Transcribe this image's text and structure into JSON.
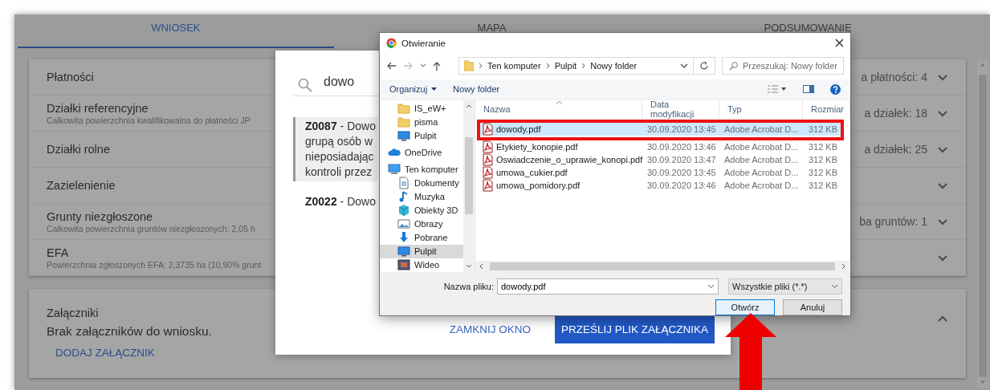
{
  "tabs": [
    {
      "label": "WNIOSEK",
      "selected": true
    },
    {
      "label": "MAPA",
      "selected": false
    },
    {
      "label": "PODSUMOWANIE",
      "selected": false
    }
  ],
  "sections": [
    {
      "title": "Płatności",
      "summary": "a płatności: 4",
      "expanded": false
    },
    {
      "title": "Działki referencyjne",
      "subtitle": "Całkowita powierzchnia kwalifikowalna do płatności JP",
      "summary": "a działek: 18",
      "expanded": false
    },
    {
      "title": "Działki rolne",
      "summary": "a działek: 25",
      "expanded": false
    },
    {
      "title": "Zazielenienie",
      "expanded": false
    },
    {
      "title": "Grunty niezgłoszone",
      "subtitle": "Całkowita powierzchnia gruntów niezgłoszonych: 2,05 h",
      "summary": "ba gruntów: 1",
      "expanded": false
    },
    {
      "title": "EFA",
      "subtitle": "Powierzchnia zgłoszonych EFA: 2,3735 ha (10,90% grunt",
      "expanded": false
    }
  ],
  "attachments": {
    "title": "Załączniki",
    "expanded": true,
    "message": "Brak załączników do wniosku.",
    "add_link": "DODAJ ZAŁĄCZNIK"
  },
  "modal": {
    "search": {
      "value": "dowo"
    },
    "results": [
      {
        "lines": [
          "**Z0087** - Dowo",
          "grupą osób w",
          "nieposiadając",
          "kontroli przez"
        ],
        "selected": true
      },
      {
        "lines": [
          "**Z0022** - Dowo"
        ],
        "selected": false
      }
    ],
    "buttons": [
      {
        "label": "ZAMKNIJ OKNO",
        "kind": "text"
      },
      {
        "label": "PRZEŚLIJ PLIK ZAŁĄCZNIKA",
        "kind": "primary"
      }
    ]
  },
  "file_dialog": {
    "title": "Otwieranie",
    "path": [
      "Ten komputer",
      "Pulpit",
      "Nowy folder"
    ],
    "search": {
      "placeholder": "Przeszukaj: Nowy folder"
    },
    "toolbar": [
      "Organizuj",
      "Nowy folder"
    ],
    "nav_pane": {
      "quick_access_items": [
        {
          "label": "IS_eW+",
          "kind": "folder",
          "selected": false
        },
        {
          "label": "pisma",
          "kind": "folder",
          "selected": false
        },
        {
          "label": "Pulpit",
          "kind": "desktop",
          "selected": false
        }
      ],
      "locations": [
        {
          "label": "OneDrive",
          "kind": "cloud",
          "selected": false
        },
        {
          "label": "Ten komputer",
          "kind": "computer",
          "selected": false,
          "children": [
            {
              "label": "Dokumenty",
              "kind": "document",
              "selected": false
            },
            {
              "label": "Muzyka",
              "kind": "music",
              "selected": false
            },
            {
              "label": "Obiekty 3D",
              "kind": "cube",
              "selected": false
            },
            {
              "label": "Obrazy",
              "kind": "picture",
              "selected": false
            },
            {
              "label": "Pobrane",
              "kind": "download",
              "selected": false
            },
            {
              "label": "Pulpit",
              "kind": "desktop",
              "selected": true
            },
            {
              "label": "Wideo",
              "kind": "video",
              "selected": false
            }
          ]
        }
      ]
    },
    "columns": [
      "Nazwa",
      "Data modyfikacji",
      "Typ",
      "Rozmiar"
    ],
    "files": [
      {
        "name": "dowody.pdf",
        "modified": "30.09.2020 13:45",
        "type": "Adobe Acrobat D...",
        "size": "312 KB",
        "selected": true
      },
      {
        "name": "Etykiety_konopie.pdf",
        "modified": "30.09.2020 13:46",
        "type": "Adobe Acrobat D...",
        "size": "312 KB",
        "selected": false
      },
      {
        "name": "Oswiadczenie_o_uprawie_konopi.pdf",
        "modified": "30.09.2020 13:47",
        "type": "Adobe Acrobat D...",
        "size": "312 KB",
        "selected": false
      },
      {
        "name": "umowa_cukier.pdf",
        "modified": "30.09.2020 13:45",
        "type": "Adobe Acrobat D...",
        "size": "312 KB",
        "selected": false
      },
      {
        "name": "umowa_pomidory.pdf",
        "modified": "30.09.2020 13:46",
        "type": "Adobe Acrobat D...",
        "size": "312 KB",
        "selected": false
      }
    ],
    "filename_label": "Nazwa pliku:",
    "filename": {
      "value": "dowody.pdf"
    },
    "filter": {
      "value": "Wszystkie pliki (*.*)"
    },
    "buttons": [
      {
        "label": "Otwórz",
        "kind": "default"
      },
      {
        "label": "Anuluj",
        "kind": "normal"
      }
    ]
  }
}
